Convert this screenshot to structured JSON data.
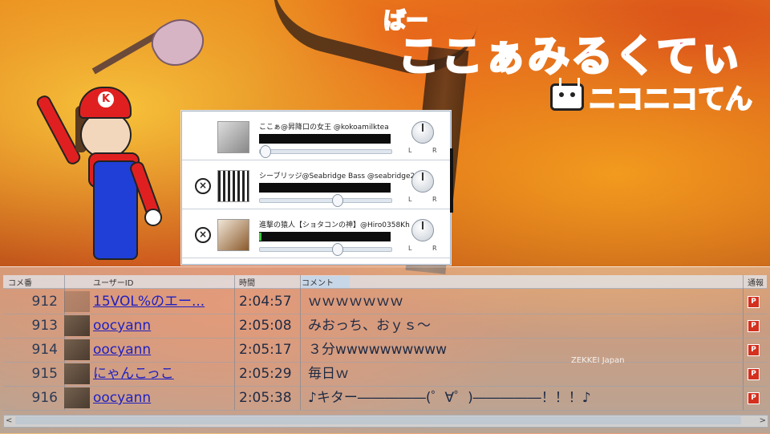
{
  "title": {
    "small": "ばー",
    "main": "ここぁみるくてぃ",
    "network": "ニコニコてん"
  },
  "colors": {
    "title_pink": "#e83a5a",
    "nico_orange": "#e8462a",
    "link_blue": "#2020c0",
    "flag_red": "#d4301e"
  },
  "mixer": {
    "rows": [
      {
        "name": "ここぁ@昇降口の女王 @kokoamilktea",
        "has_close": false,
        "slider_pos": 0.04,
        "meter_active": false
      },
      {
        "name": "シーブリッジ@Seabridge Bass @seabridge25...",
        "has_close": true,
        "slider_pos": 0.58,
        "meter_active": false
      },
      {
        "name": "進撃の猿人【ショタコンの神】@Hiro0358Kh",
        "has_close": true,
        "slider_pos": 0.58,
        "meter_active": true
      }
    ],
    "knob_left": "L",
    "knob_right": "R",
    "close_icon": "close-circle-icon"
  },
  "comments": {
    "headers": {
      "number": "コメ番",
      "user": "ユーザーID",
      "time": "時間",
      "comment": "コメント",
      "report": "通報"
    },
    "rows": [
      {
        "number": "912",
        "user": "15VOL%のエー...",
        "time": "2:04:57",
        "text": "ｗｗｗｗｗｗｗ"
      },
      {
        "number": "913",
        "user": "oocyann",
        "time": "2:05:08",
        "text": "みおっち、おｙｓ～"
      },
      {
        "number": "914",
        "user": "oocyann",
        "time": "2:05:17",
        "text": "３分wwwwwwwwww"
      },
      {
        "number": "915",
        "user": "にゃんこっこ",
        "time": "2:05:29",
        "text": "毎日ｗ"
      },
      {
        "number": "916",
        "user": "oocyann",
        "time": "2:05:38",
        "text": "♪キター―――――(゜∀゜)―――――！！！♪"
      }
    ],
    "flag_label": "P"
  },
  "watermark": "ZEKKEI Japan",
  "character_cap_letter": "K"
}
